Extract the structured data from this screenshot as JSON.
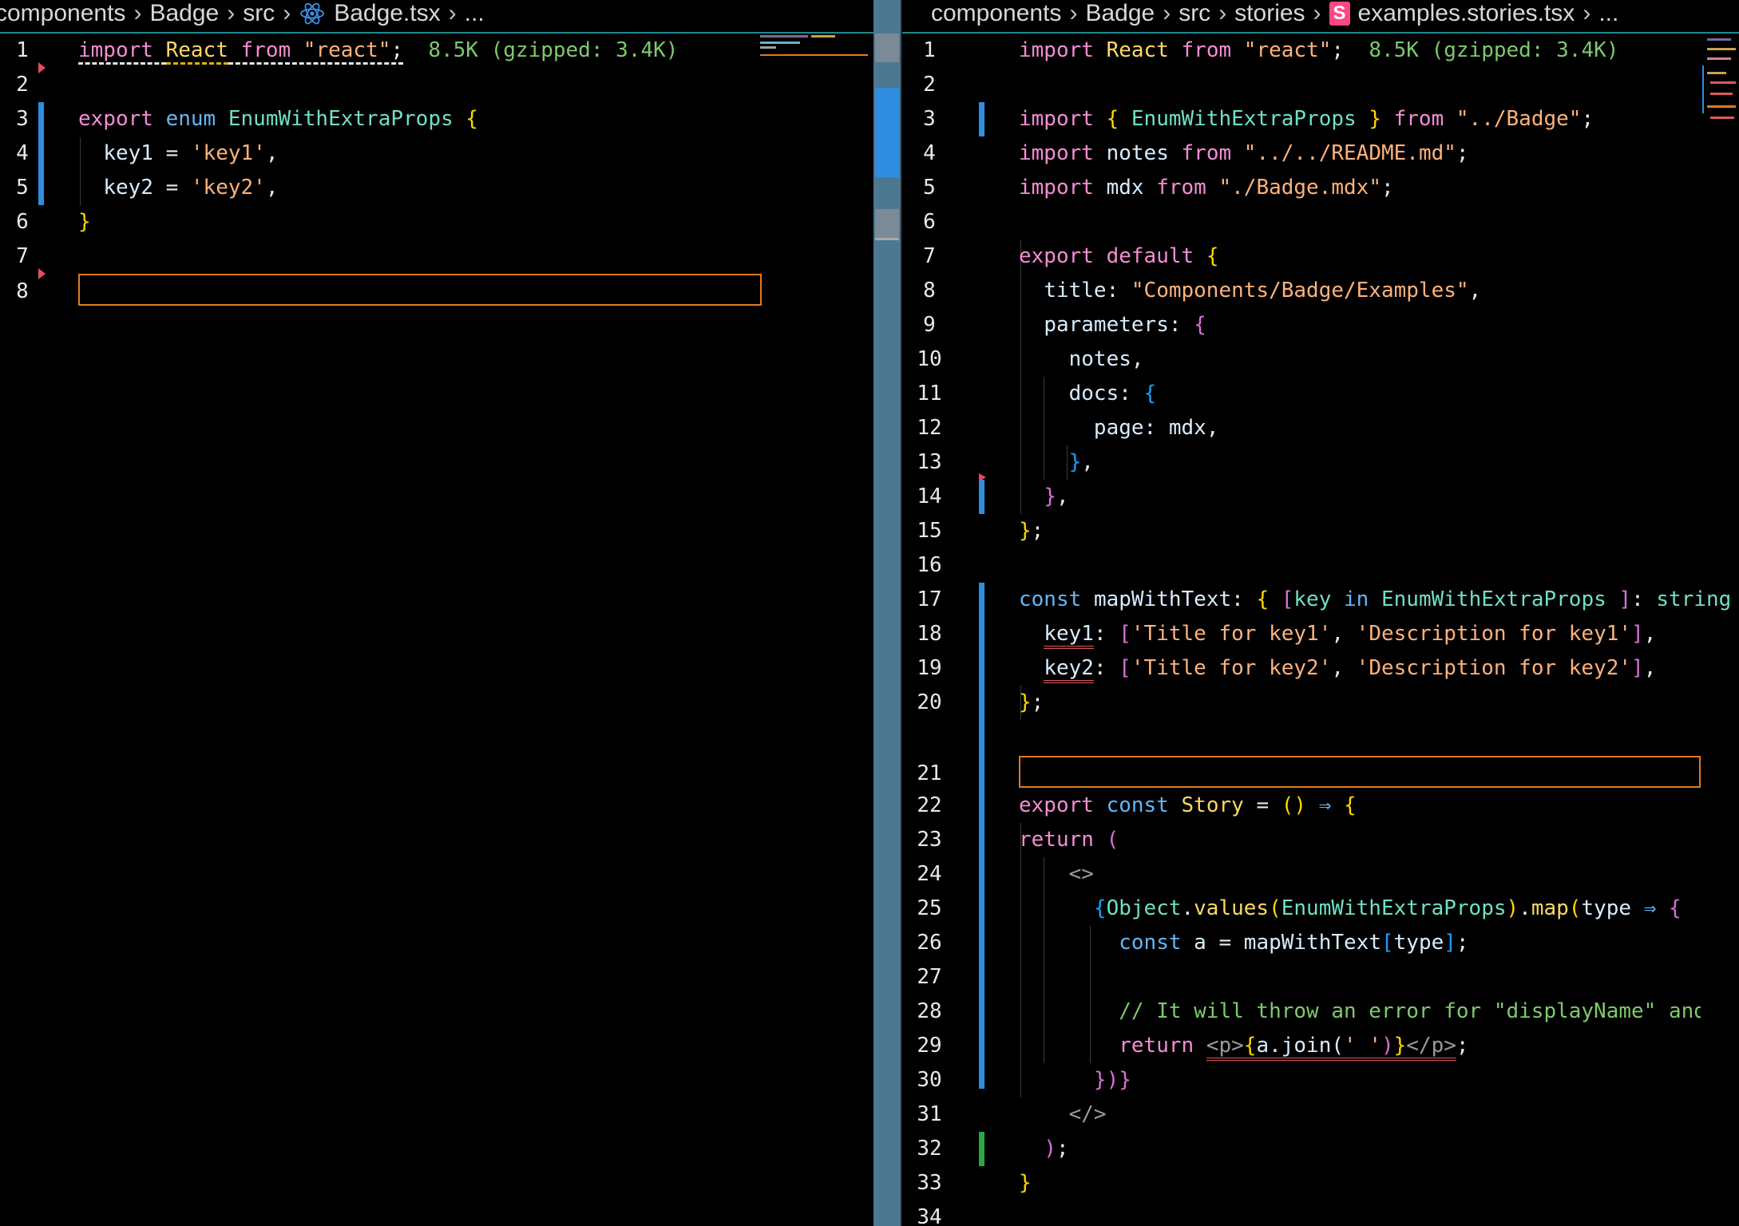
{
  "left_pane": {
    "breadcrumb": [
      "components",
      "Badge",
      "src"
    ],
    "file_icon": "react-icon",
    "file_name": "Badge.tsx",
    "trailing": "...",
    "import_line": {
      "kw_import": "import",
      "name": "React",
      "kw_from": "from",
      "module": "\"react\"",
      "semi": ";",
      "size": "8.5K (gzipped: 3.4K)"
    },
    "enum_line": {
      "kw_export": "export",
      "kw_enum": "enum",
      "name": "EnumWithExtraProps",
      "brace": "{"
    },
    "key1_line": {
      "key": "key1",
      "eq": " = ",
      "value": "'key1'",
      "comma": ","
    },
    "key2_line": {
      "key": "key2",
      "eq": " = ",
      "value": "'key2'",
      "comma": ","
    },
    "close_line": {
      "brace": "}"
    },
    "line_numbers": [
      "1",
      "2",
      "3",
      "4",
      "5",
      "6",
      "7",
      "8"
    ]
  },
  "right_pane": {
    "breadcrumb": [
      "components",
      "Badge",
      "src",
      "stories"
    ],
    "file_icon": "storybook-icon",
    "file_icon_letter": "S",
    "file_name": "examples.stories.tsx",
    "trailing": "...",
    "line_numbers": [
      "1",
      "2",
      "3",
      "4",
      "5",
      "6",
      "7",
      "8",
      "9",
      "10",
      "11",
      "12",
      "13",
      "14",
      "15",
      "16",
      "17",
      "18",
      "19",
      "20",
      "21",
      "22",
      "23",
      "24",
      "25",
      "26",
      "27",
      "28",
      "29",
      "30",
      "31",
      "32",
      "33",
      "34"
    ],
    "l1": {
      "kw_import": "import",
      "name": "React",
      "kw_from": "from",
      "module": "\"react\"",
      "semi": ";",
      "size": "8.5K (gzipped: 3.4K)"
    },
    "l3": {
      "kw_import": "import",
      "ob": "{",
      "name": "EnumWithExtraProps",
      "cb": "}",
      "kw_from": "from",
      "module": "\"../Badge\"",
      "semi": ";"
    },
    "l4": {
      "kw_import": "import",
      "name": "notes",
      "kw_from": "from",
      "module": "\"../../README.md\"",
      "semi": ";"
    },
    "l5": {
      "kw_import": "import",
      "name": "mdx",
      "kw_from": "from",
      "module": "\"./Badge.mdx\"",
      "semi": ";"
    },
    "l7": {
      "kw_export": "export",
      "kw_default": "default",
      "brace": "{"
    },
    "l8": {
      "prop": "title:",
      "value": "\"Components/Badge/Examples\"",
      "comma": ","
    },
    "l9": {
      "prop": "parameters:",
      "brace": "{"
    },
    "l10": {
      "prop": "notes",
      "comma": ","
    },
    "l11": {
      "prop": "docs:",
      "brace": "{"
    },
    "l12": {
      "prop": "page:",
      "value": "mdx",
      "comma": ","
    },
    "l13": {
      "brace": "}",
      "comma": ","
    },
    "l14": {
      "brace": "}",
      "comma": ","
    },
    "l15": {
      "brace": "}",
      "semi": ";"
    },
    "l17": {
      "kw_const": "const",
      "name": "mapWithText",
      "colon": ":",
      "ob": "{",
      "osq": "[",
      "key": "key",
      "kw_in": "in",
      "enum": "EnumWithExtraProps",
      "csq": "]",
      "colon2": ":",
      "type": "string",
      "cb": "}"
    },
    "l18": {
      "key": "key1",
      "colon": ":",
      "osq": "[",
      "s1": "'Title for key1'",
      "comma1": ",",
      "s2": "'Description for key1'",
      "csq": "]",
      "comma": ","
    },
    "l19": {
      "key": "key2",
      "colon": ":",
      "osq": "[",
      "s1": "'Title for key2'",
      "comma1": ",",
      "s2": "'Description for key2'",
      "csq": "]",
      "comma": ","
    },
    "l20": {
      "brace": "}",
      "semi": ";"
    },
    "l22": {
      "kw_export": "export",
      "kw_const": "const",
      "name": "Story",
      "eq": "=",
      "parens": "()",
      "arrow": "⇒",
      "brace": "{"
    },
    "l23": {
      "kw_return": "return",
      "paren": "("
    },
    "l24": {
      "frag": "<>"
    },
    "l25": {
      "ob": "{",
      "obj": "Object",
      "dot1": ".",
      "values": "values",
      "op": "(",
      "enum": "EnumWithExtraProps",
      "cp": ")",
      "dot2": ".",
      "map": "map",
      "op2": "(",
      "param": "type",
      "arrow": "⇒",
      "brace": "{"
    },
    "l26": {
      "kw_const": "const",
      "name": "a",
      "eq": "=",
      "map": "mapWithText",
      "osq": "[",
      "idx": "type",
      "csq": "]",
      "semi": ";"
    },
    "l28": {
      "comment": "// It will throw an error for \"displayName\" and \"__("
    },
    "l29": {
      "kw_return": "return",
      "tag_open": "<p>",
      "ob": "{",
      "expr": "a.join(",
      "str": "' '",
      "cp": ")",
      "cb": "}",
      "tag_close": "</p>",
      "semi": ";"
    },
    "l30": {
      "close": "})}"
    },
    "l31": {
      "frag": "</>"
    },
    "l32": {
      "paren": ")",
      "semi": ";"
    },
    "l33": {
      "brace": "}"
    }
  },
  "colors": {
    "keyword": "#f58cd4",
    "keyword_blue": "#64b5f6",
    "string": "#ffb27a",
    "type": "#6fe0c6",
    "identifier": "#d7ecff",
    "comment": "#7ec96e",
    "change_bar": "#2f8ee0",
    "added_bar": "#28a745",
    "current_line_border": "#e07a1e",
    "breadcrumb_border": "#1c8b8e",
    "scrollbar": "#4d7891"
  }
}
